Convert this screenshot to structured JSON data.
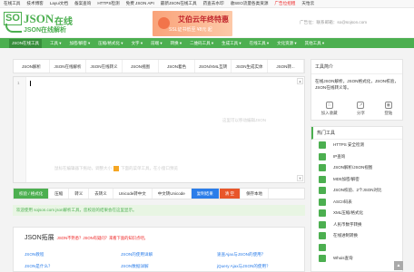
{
  "topbar": {
    "links": [
      "在线工具",
      "技术博客",
      "Layui文档",
      "备案查询",
      "HTTPS检测",
      "免费 JSON API",
      "最新JSON在线工具",
      "药查去水印",
      "收SEO流量各类资源",
      "广告位招租",
      "天怡云"
    ],
    "highlight_index": 9
  },
  "logo": {
    "so": "SO",
    "json": "JSON",
    "zx": "在线",
    "sub": "JSON在线解析"
  },
  "ad": {
    "title": "艾伯云年终特惠",
    "sub": "SSL证书低至 ¥8元 起"
  },
  "header": {
    "ad_contact": "广告位：联系邮箱：so@sojson.com"
  },
  "nav": {
    "items": [
      "JSON在线工具",
      "工具 ▾",
      "加密/解密 ▾",
      "压缩/格式化 ▾",
      "文字 ▾",
      "前端 ▾",
      "转换 ▾",
      "二维码工具 ▾",
      "生成工具 ▾",
      "在线工具 ▾",
      "文化资源 ▾",
      "其他工具 ▾"
    ],
    "active_index": 0
  },
  "tool_tabs": [
    "JSON解析",
    "JSON在线解析",
    "JSON在线转义",
    "JSON视图",
    "JSON着色",
    "JSON/XML互转",
    "JSON生成实体",
    "JSON转..."
  ],
  "editor": {
    "line": "1",
    "hint_top": "这里可以移动编辑JSON",
    "hint_mid_a": "鼠标在编辑器下拖动，调整大小",
    "hint_mid_b": "下面的菜单工具，在小窗口预览"
  },
  "actions": [
    {
      "label": "校验 / 格式化",
      "style": "green"
    },
    {
      "label": "压缩",
      "style": ""
    },
    {
      "label": "转义",
      "style": ""
    },
    {
      "label": "去转义",
      "style": ""
    },
    {
      "label": "Unicode转中文",
      "style": ""
    },
    {
      "label": "中文转Unicode",
      "style": ""
    },
    {
      "label": "复制结果",
      "style": "blue"
    },
    {
      "label": "清 空",
      "style": "red"
    },
    {
      "label": "保存本地",
      "style": ""
    }
  ],
  "notice": "欢迎使用 sojson.com json解析工具，您校验的结果会在这里显示。",
  "expand": {
    "title": "JSON拓展",
    "subtitle": "JSON不熟悉？JSON有疑问？来看下面的知识点吧。",
    "links": [
      "JSON教程",
      "JSON是什么？",
      "JSON的使用详解",
      "JSON数据详解",
      "速查Ajax与JSON的使用？",
      "jQuery Ajax与JSON的使用？"
    ]
  },
  "sidebar_intro": {
    "title": "工具简介",
    "desc": "在线JSON解析，JSON格式化，JSON校验，JSON在线转义等。",
    "icons": [
      {
        "label": "加入收藏",
        "icon": "star-icon"
      },
      {
        "label": "分享",
        "icon": "share-icon"
      },
      {
        "label": "登陆",
        "icon": "user-icon"
      }
    ]
  },
  "sidebar_hot": {
    "title": "热门工具",
    "items": [
      "HTTPS 安全检测",
      "IP查询",
      "JSON解析/JSON视图",
      "MD5加密/解密",
      "JSON校验、2个JSON对比",
      "ASCII码表",
      "XML压缩/格式化",
      "人民币数字转换",
      "在线进制转换",
      "",
      "Whois查询"
    ]
  },
  "colors": {
    "brand_green": "#4caf50",
    "link_blue": "#2b7de9",
    "danger": "#e8562a"
  }
}
